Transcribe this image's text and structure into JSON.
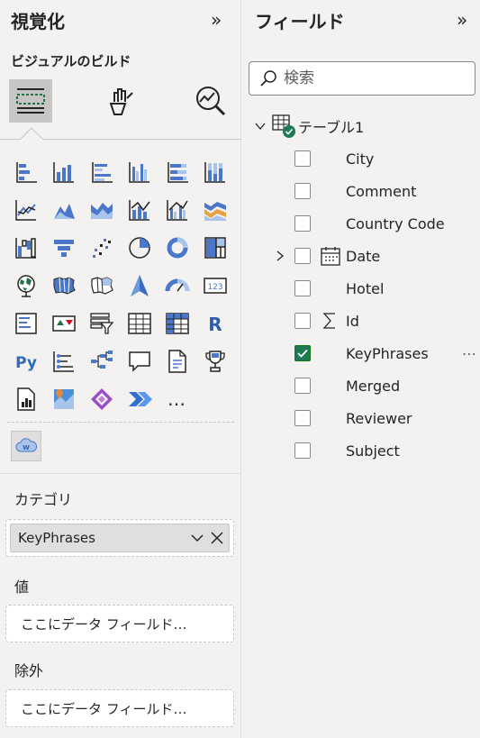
{
  "visualizations": {
    "title": "視覚化",
    "collapse_glyph": "»",
    "build_title": "ビジュアルのビルド",
    "tabs": [
      {
        "icon": "build-visual-icon",
        "active": true
      },
      {
        "icon": "format-visual-icon",
        "active": false
      },
      {
        "icon": "analytics-icon",
        "active": false
      }
    ],
    "more_label": "…",
    "wells": {
      "category_label": "カテゴリ",
      "category_field": "KeyPhrases",
      "values_label": "値",
      "values_placeholder": "ここにデータ フィールド…",
      "exclude_label": "除外",
      "exclude_placeholder": "ここにデータ フィールド…"
    }
  },
  "fields": {
    "title": "フィールド",
    "collapse_glyph": "»",
    "search_placeholder": "検索",
    "table_name": "テーブル1",
    "items": [
      {
        "name": "City",
        "checked": false,
        "icon": ""
      },
      {
        "name": "Comment",
        "checked": false,
        "icon": ""
      },
      {
        "name": "Country Code",
        "checked": false,
        "icon": ""
      },
      {
        "name": "Date",
        "checked": false,
        "icon": "calendar-icon",
        "expandable": true
      },
      {
        "name": "Hotel",
        "checked": false,
        "icon": ""
      },
      {
        "name": "Id",
        "checked": false,
        "icon": "sigma-icon"
      },
      {
        "name": "KeyPhrases",
        "checked": true,
        "icon": ""
      },
      {
        "name": "Merged",
        "checked": false,
        "icon": ""
      },
      {
        "name": "Reviewer",
        "checked": false,
        "icon": ""
      },
      {
        "name": "Subject",
        "checked": false,
        "icon": ""
      }
    ],
    "more_glyph": "⋯"
  },
  "colors": {
    "accent_blue": "#4a77c9",
    "accent_light_blue": "#a9c4eb",
    "check_green": "#1f7a54"
  }
}
